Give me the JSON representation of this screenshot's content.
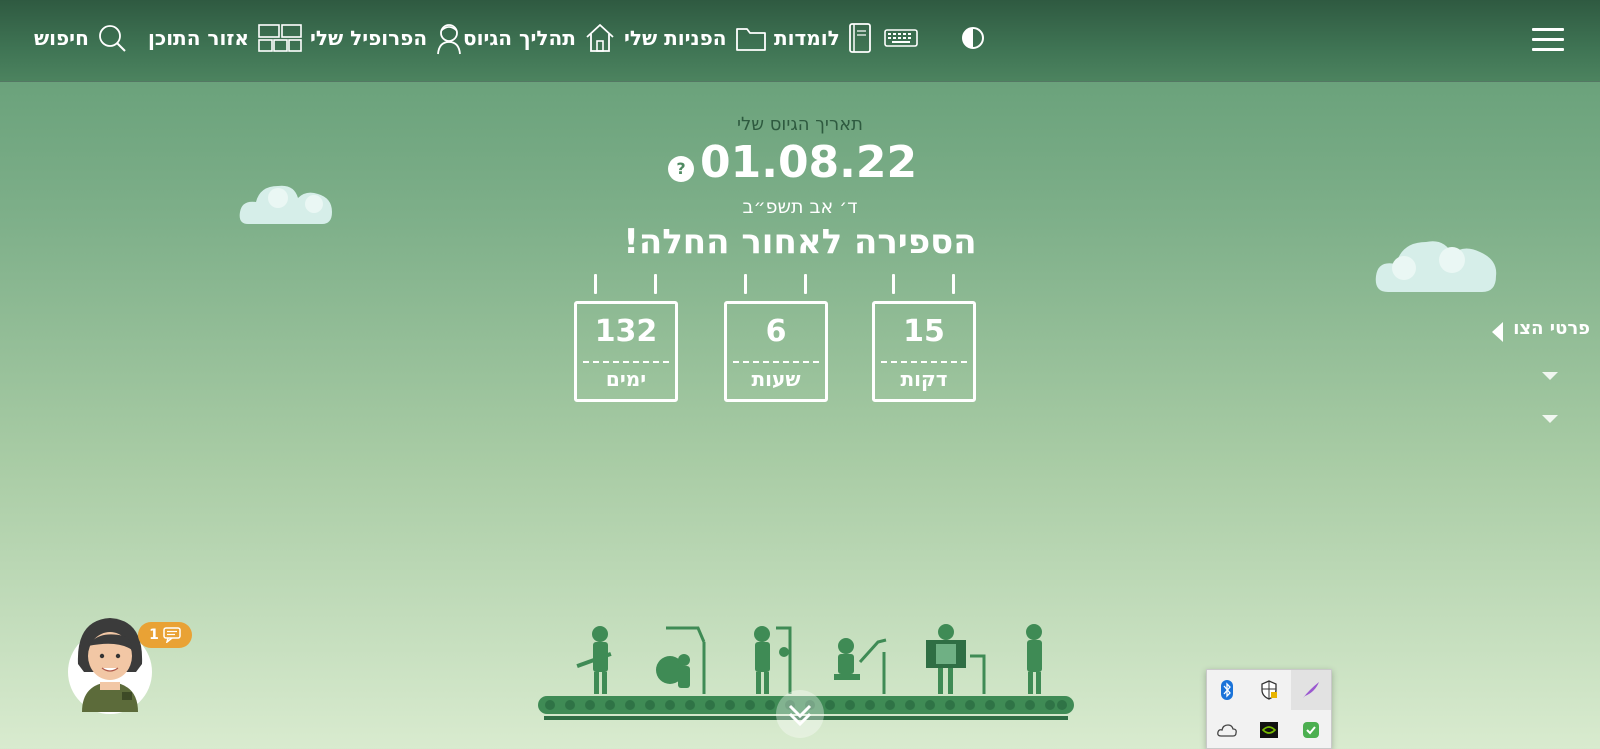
{
  "nav": {
    "search_label": "חיפוש",
    "content_area_label": "אזור התוכן",
    "profile_label": "הפרופיל שלי",
    "enlistment_label": "תהליך הגיוס",
    "requests_label": "הפניות שלי",
    "learning_label": "לומדות",
    "icons": {
      "search": "search-icon",
      "content_area": "grid-icon",
      "profile": "person-icon",
      "enlistment": "home-icon",
      "requests": "folder-icon",
      "learning": "book-icon",
      "keyboard": "keyboard-icon",
      "contrast": "contrast-icon",
      "menu": "hamburger-menu-icon"
    }
  },
  "hero": {
    "subtitle": "תאריך הגיוס שלי",
    "date": "01.08.22",
    "hebrew_date": "ד׳ אב תשפ״ב",
    "headline": "הספירה לאחור החלה!",
    "help_glyph": "?"
  },
  "countdown": [
    {
      "value": "15",
      "unit": "דקות"
    },
    {
      "value": "6",
      "unit": "שעות"
    },
    {
      "value": "132",
      "unit": "ימים"
    }
  ],
  "side": {
    "details_label": "פרטי הצו"
  },
  "chat": {
    "unread_count": "1"
  },
  "tray": {
    "icons": [
      "bluetooth-icon",
      "security-shield-icon",
      "feather-icon",
      "cloud-icon",
      "nvidia-icon",
      "check-shield-icon"
    ]
  },
  "colors": {
    "topbar": "#3f7454",
    "badge": "#e9a235",
    "accent_dark_green": "#2e5a3f"
  }
}
